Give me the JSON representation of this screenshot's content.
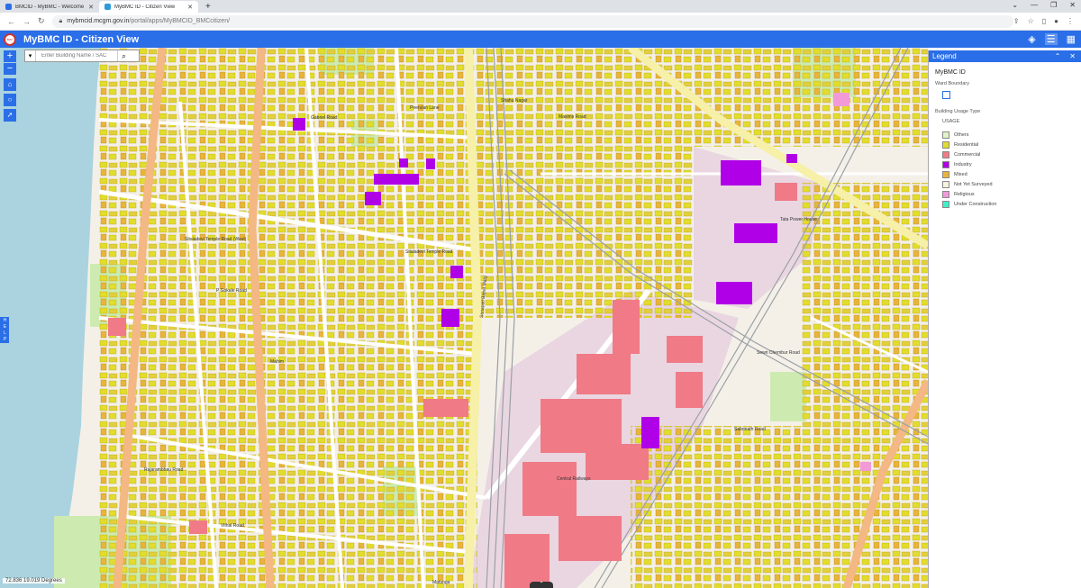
{
  "browser": {
    "tabs": [
      {
        "title": "BMCID - MyBMC - Welcome to I",
        "active": false,
        "favicon_color": "#2a6ee8"
      },
      {
        "title": "MyBMC ID - Citizen View",
        "active": true,
        "favicon_color": "#2e9bd6"
      }
    ],
    "new_tab": "+",
    "url_host": "mybmcid.mcgm.gov.in",
    "url_path": "/portal/apps/MyBMCID_BMCcitizen/"
  },
  "app": {
    "title": "MyBMC ID - Citizen View",
    "logo_text": "BMC"
  },
  "search": {
    "placeholder": "Enter Building Name / SAC"
  },
  "zoom": {
    "in": "+",
    "out": "−"
  },
  "help": {
    "label": "HELP"
  },
  "coords": {
    "text": "72.836 19.019 Degrees"
  },
  "legend": {
    "title": "Legend",
    "layer_name": "MyBMC ID",
    "ward_label": "Ward Boundary",
    "usage_type_label": "Building Usage Type",
    "usage_header": "USAGE",
    "items": [
      {
        "label": "Others",
        "color": "#dff5c8"
      },
      {
        "label": "Residential",
        "color": "#e2dc2c"
      },
      {
        "label": "Commercial",
        "color": "#f07a86"
      },
      {
        "label": "Industry",
        "color": "#b000e8"
      },
      {
        "label": "Mixed",
        "color": "#e8b53a"
      },
      {
        "label": "Not Yet Surveyed",
        "color": "#f8f0e0"
      },
      {
        "label": "Religious",
        "color": "#f29ad8"
      },
      {
        "label": "Under Construction",
        "color": "#3ff0c8"
      }
    ]
  },
  "map_labels": [
    "Gabriel Road",
    "Peerulan Lane",
    "Shahu Nagar",
    "Sitaladevi Temple Road",
    "Sitaladevi Temple Road (West)",
    "P Gokale Road",
    "Senapati Bapat Marg",
    "Mahim",
    "Matunga",
    "Tata Power House",
    "Maxims Road",
    "Sewri Chembur Road",
    "Central Railways",
    "Sabrinath Road",
    "Rajarambhau Road",
    "Vithal Road"
  ]
}
